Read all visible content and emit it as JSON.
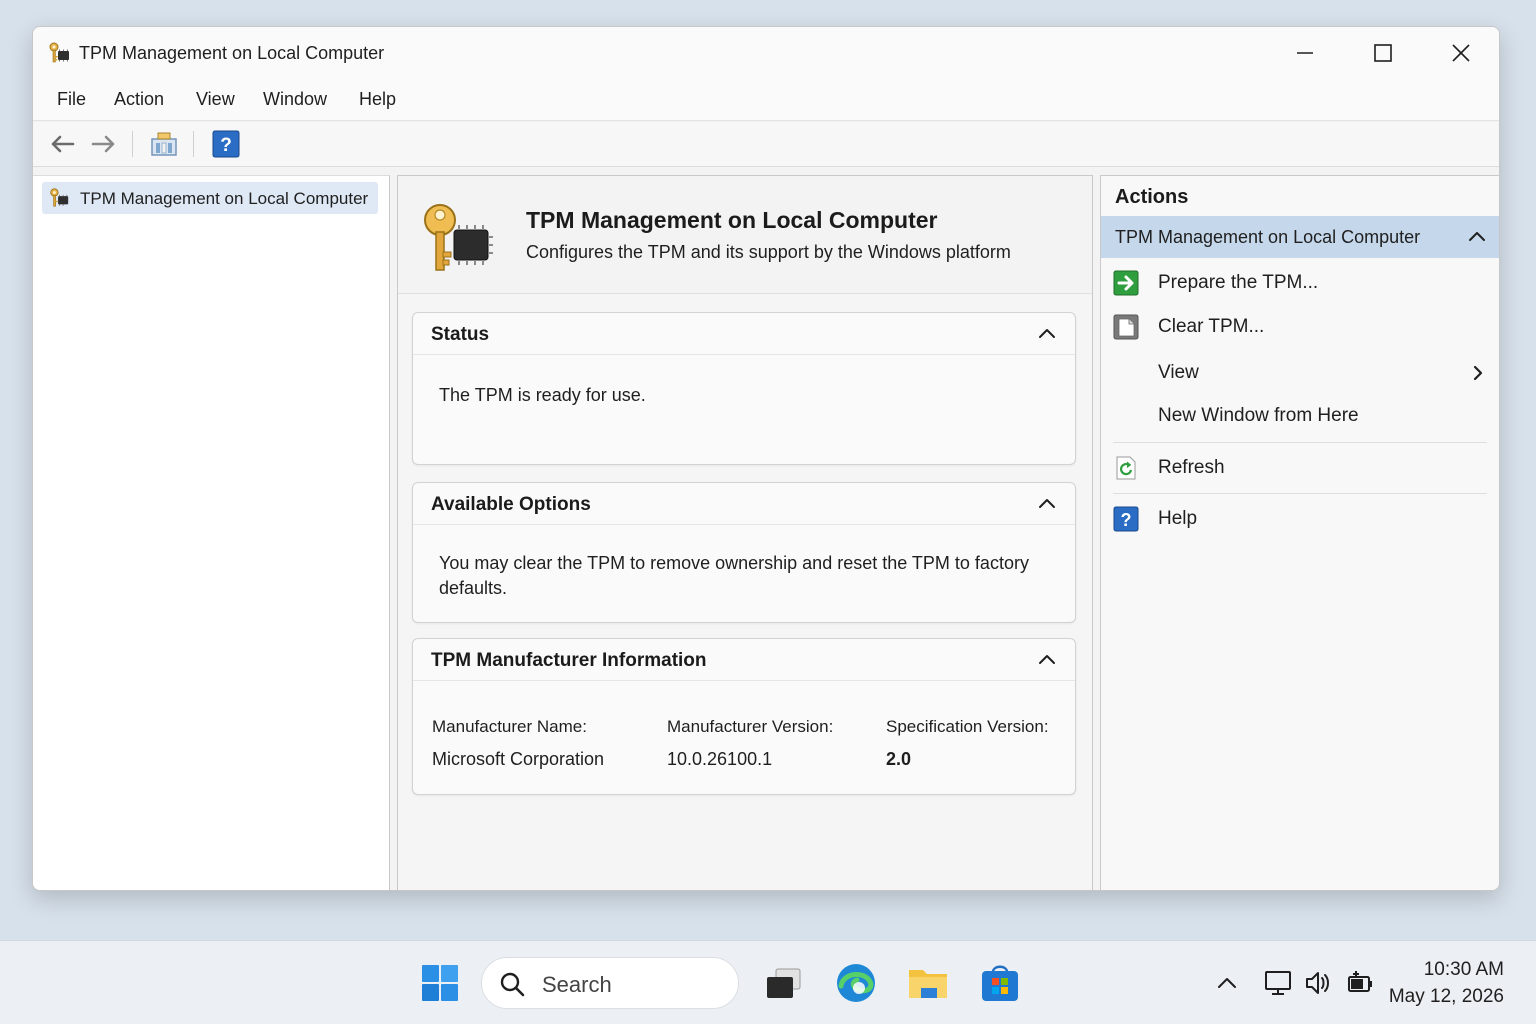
{
  "window": {
    "title": "TPM Management on Local Computer"
  },
  "menu": [
    "File",
    "Action",
    "View",
    "Window",
    "Help"
  ],
  "tree": {
    "items": [
      {
        "label": "TPM Management on Local Computer",
        "selected": true
      }
    ]
  },
  "header": {
    "title": "TPM Management on Local Computer",
    "subtitle": "Configures the TPM and its support by the Windows platform"
  },
  "sections": {
    "status": {
      "title": "Status",
      "text": "The TPM is ready for use."
    },
    "options": {
      "title": "Available Options",
      "text": "You may clear the TPM to remove ownership and reset the TPM to factory defaults."
    },
    "manufacturer": {
      "title": "TPM Manufacturer Information",
      "name_label": "Manufacturer Name:",
      "name_value": "Microsoft Corporation",
      "version_label": "Manufacturer Version:",
      "version_value": "10.0.26100.1",
      "spec_label": "Specification Version:",
      "spec_value": "2.0"
    }
  },
  "actions": {
    "title": "Actions",
    "group_label": "TPM Management on Local Computer",
    "items": [
      {
        "label": "Prepare the TPM...",
        "icon": "arrow-right-green-icon"
      },
      {
        "label": "Clear TPM...",
        "icon": "clear-page-icon"
      },
      {
        "label": "View",
        "icon": "none",
        "submenu": true
      },
      {
        "label": "New Window from Here",
        "icon": "none"
      },
      {
        "label": "Refresh",
        "icon": "refresh-icon"
      },
      {
        "label": "Help",
        "icon": "help-icon"
      }
    ]
  },
  "taskbar": {
    "search_placeholder": "Search",
    "time": "10:30 AM",
    "date": "May 12, 2026"
  },
  "colors": {
    "accent": "#0067c0",
    "selection": "#c5d7ea",
    "tree_selection": "#dfe9f5"
  }
}
